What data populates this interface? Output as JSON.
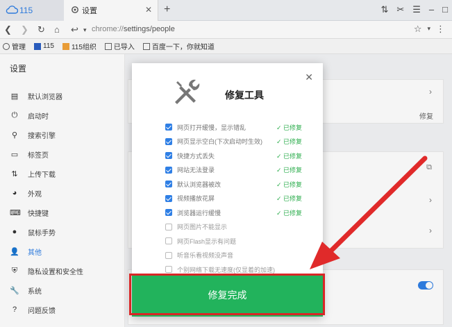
{
  "browser": {
    "tabs": [
      {
        "label": "115"
      },
      {
        "label": "设置"
      }
    ],
    "url_prefix": "chrome://",
    "url_path": "settings/people",
    "bookmarks": [
      "管理",
      "115",
      "115组织",
      "已导入",
      "百度一下，你就知道"
    ]
  },
  "sidebar": {
    "title": "设置",
    "items": [
      {
        "label": "默认浏览器",
        "icon": "browser-icon"
      },
      {
        "label": "启动时",
        "icon": "power-icon"
      },
      {
        "label": "搜索引擎",
        "icon": "search-icon"
      },
      {
        "label": "标签页",
        "icon": "tab-icon"
      },
      {
        "label": "上传下载",
        "icon": "transfer-icon"
      },
      {
        "label": "外观",
        "icon": "palette-icon"
      },
      {
        "label": "快捷键",
        "icon": "keyboard-icon"
      },
      {
        "label": "鼠标手势",
        "icon": "mouse-icon"
      },
      {
        "label": "其他",
        "icon": "person-icon"
      },
      {
        "label": "隐私设置和安全性",
        "icon": "shield-icon"
      },
      {
        "label": "系统",
        "icon": "wrench-icon"
      },
      {
        "label": "问题反馈",
        "icon": "help-icon"
      }
    ]
  },
  "content": {
    "repair_label": "修复"
  },
  "modal": {
    "title": "修复工具",
    "items": [
      {
        "label": "网页打开缓慢，显示错乱",
        "checked": true,
        "status": "✓ 已修复"
      },
      {
        "label": "网页显示空白(下次启动时生效)",
        "checked": true,
        "status": "✓ 已修复"
      },
      {
        "label": "快捷方式丢失",
        "checked": true,
        "status": "✓ 已修复"
      },
      {
        "label": "网站无法登录",
        "checked": true,
        "status": "✓ 已修复"
      },
      {
        "label": "默认浏览器被改",
        "checked": true,
        "status": "✓ 已修复"
      },
      {
        "label": "视频播放花屏",
        "checked": true,
        "status": "✓ 已修复"
      },
      {
        "label": "浏览器运行缓慢",
        "checked": true,
        "status": "✓ 已修复"
      },
      {
        "label": "网页图片不能显示",
        "checked": false,
        "status": ""
      },
      {
        "label": "网页Flash显示有问题",
        "checked": false,
        "status": ""
      },
      {
        "label": "听音乐看视频没声音",
        "checked": false,
        "status": ""
      },
      {
        "label": "个别网络下载无速度(仅显着的加速)",
        "checked": false,
        "status": ""
      }
    ],
    "done_label": "修复完成"
  },
  "colors": {
    "accent": "#2f7fe5",
    "success": "#2fae4f",
    "done_button": "#22b35c",
    "highlight": "#d82626"
  }
}
